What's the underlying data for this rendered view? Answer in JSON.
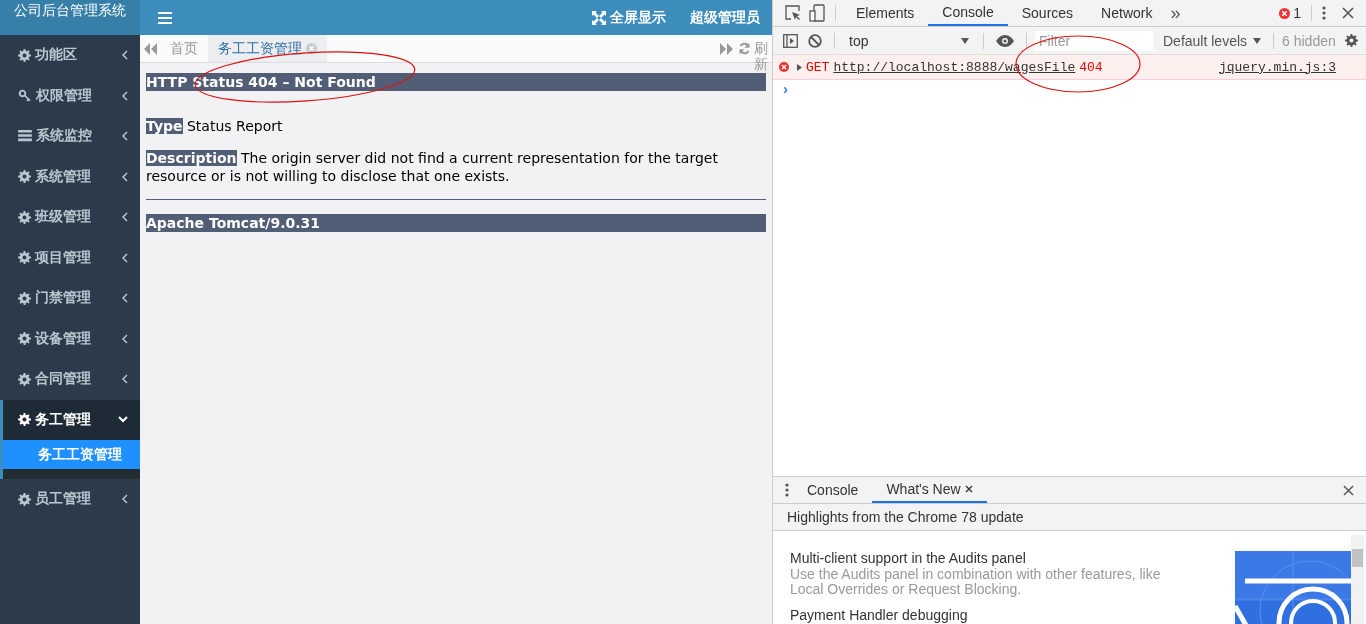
{
  "app": {
    "logo": "公司后台管理系统",
    "toolbar": [
      {
        "kind": "fullscreen",
        "label": "全屏显示"
      },
      {
        "kind": "user",
        "label": "超级管理员"
      }
    ],
    "sidebar": {
      "items": [
        {
          "label": "功能区",
          "expanded": false
        },
        {
          "label": "权限管理",
          "expanded": false
        },
        {
          "label": "系统监控",
          "expanded": false
        },
        {
          "label": "系统管理",
          "expanded": false
        },
        {
          "label": "班级管理",
          "expanded": false
        },
        {
          "label": "项目管理",
          "expanded": false
        },
        {
          "label": "门禁管理",
          "expanded": false
        },
        {
          "label": "设备管理",
          "expanded": false
        },
        {
          "label": "合同管理",
          "expanded": false
        },
        {
          "label": "务工管理",
          "expanded": true,
          "children": [
            {
              "label": "务工工资管理",
              "selected": true
            }
          ]
        },
        {
          "label": "员工管理",
          "expanded": false
        }
      ]
    },
    "tabs": [
      {
        "label": "首页",
        "selected": false,
        "closable": false
      },
      {
        "label": "务工工资管理",
        "selected": true,
        "closable": true
      }
    ],
    "refresh": "刷新",
    "page": {
      "title": "HTTP Status 404 – Not Found",
      "fields": [
        {
          "label": "Type",
          "text": "Status Report"
        },
        {
          "label": "Description",
          "text": "The origin server did not find a current representation for the target resource or is not willing to disclose that one exists."
        }
      ],
      "footer": "Apache Tomcat/9.0.31"
    }
  },
  "devtools": {
    "tabs": [
      {
        "label": "Elements",
        "selected": false
      },
      {
        "label": "Console",
        "selected": true
      },
      {
        "label": "Sources",
        "selected": false
      },
      {
        "label": "Network",
        "selected": false
      }
    ],
    "more": "»",
    "error_count": "1",
    "console_toolbar": {
      "context": "top",
      "filter_placeholder": "Filter",
      "levels": "Default levels",
      "hidden": "6 hidden"
    },
    "messages": [
      {
        "method": "GET",
        "url": "http://localhost:8888/wagesFile",
        "status": "404",
        "source": "jquery.min.js:3"
      }
    ],
    "prompt": "›",
    "drawer": {
      "tabs": [
        {
          "label": "Console",
          "selected": false,
          "closable": false
        },
        {
          "label": "What's New",
          "selected": true,
          "closable": true
        }
      ],
      "banner": "Highlights from the Chrome 78 update",
      "items": [
        {
          "title": "Multi-client support in the Audits panel",
          "text": "Use the Audits panel in combination with other features, like Local Overrides or Request Blocking."
        },
        {
          "title": "Payment Handler debugging"
        }
      ]
    }
  }
}
